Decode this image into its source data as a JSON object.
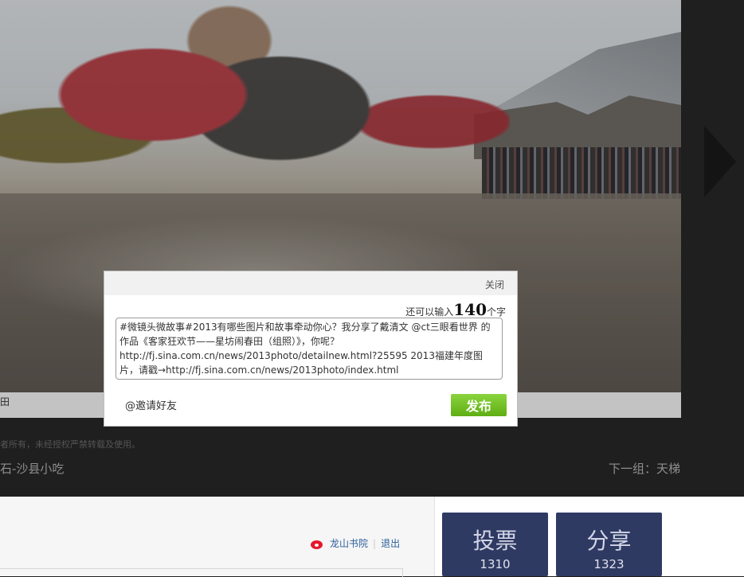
{
  "caption": "田",
  "copyright": "者所有，未经授权严禁转载及使用。",
  "nav": {
    "prev_group": "石-沙县小吃",
    "next_group": "下一组：天梯"
  },
  "share_dialog": {
    "close_label": "关闭",
    "counter": {
      "prefix": "还可以输入",
      "remaining": "140",
      "suffix": "个字"
    },
    "text": "#微镜头微故事#2013有哪些图片和故事牵动你心？我分享了戴清文 @ct三眼看世界 的作品《客家狂欢节——星坊闹春田（组照）》，你呢？http://fj.sina.com.cn/news/2013photo/detailnew.html?25595 2013福建年度图片，请戳→http://fj.sina.com.cn/news/2013photo/index.html",
    "invite_label": "@邀请好友",
    "publish_label": "发布",
    "publish_color": "#6bbf1a"
  },
  "weibo": {
    "username": "龙山书院",
    "logout_label": "退出",
    "icon": "weibo-icon"
  },
  "actions": {
    "vote": {
      "label": "投票",
      "count": "1310"
    },
    "share": {
      "label": "分享",
      "count": "1323"
    }
  }
}
